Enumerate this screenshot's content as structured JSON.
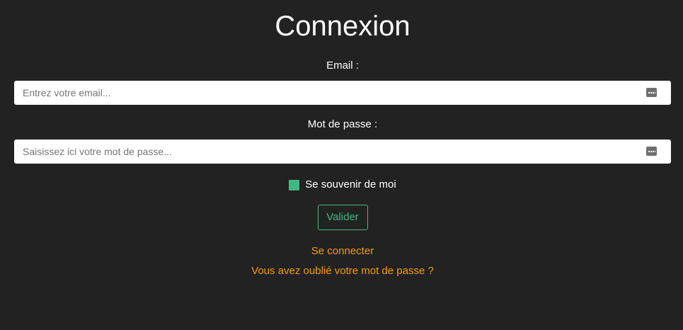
{
  "page": {
    "title": "Connexion"
  },
  "form": {
    "email": {
      "label": "Email :",
      "placeholder": "Entrez votre email...",
      "value": "",
      "icon": "password-manager-key-icon"
    },
    "password": {
      "label": "Mot de passe :",
      "placeholder": "Saisissez ici votre mot de passe...",
      "value": "",
      "icon": "password-manager-key-icon"
    },
    "remember": {
      "label": "Se souvenir de moi",
      "checked": true
    },
    "submit_label": "Valider"
  },
  "links": {
    "login": "Se connecter",
    "forgot_password": "Vous avez oublié votre mot de passe ?"
  },
  "colors": {
    "background": "#222222",
    "accent": "#41b883",
    "link": "#f39c12",
    "text": "#ffffff"
  }
}
